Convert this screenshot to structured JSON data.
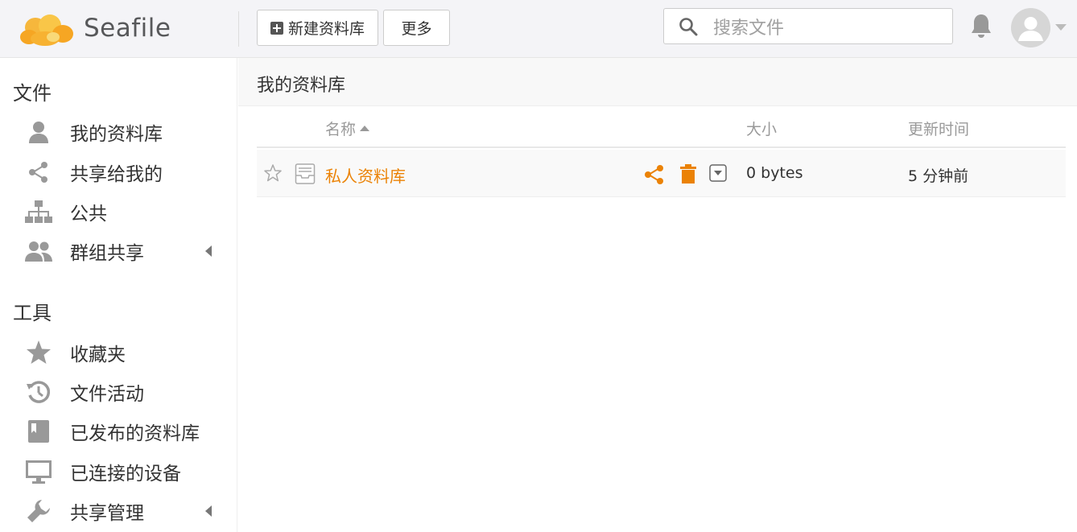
{
  "brand": {
    "name": "Seafile",
    "accent": "#eb8205",
    "logo_color": "#f6b73c"
  },
  "header": {
    "new_library_label": "新建资料库",
    "more_label": "更多",
    "search_placeholder": "搜索文件",
    "icons": {
      "new": "plus-square-icon",
      "search": "search-icon",
      "notifications": "bell-icon",
      "avatar": "user-avatar-icon"
    }
  },
  "sidebar": {
    "files_heading": "文件",
    "files_items": [
      {
        "label": "我的资料库",
        "icon": "user-icon"
      },
      {
        "label": "共享给我的",
        "icon": "share-icon"
      },
      {
        "label": "公共",
        "icon": "sitemap-icon"
      },
      {
        "label": "群组共享",
        "icon": "group-icon",
        "expandable": true
      }
    ],
    "tools_heading": "工具",
    "tools_items": [
      {
        "label": "收藏夹",
        "icon": "star-icon"
      },
      {
        "label": "文件活动",
        "icon": "history-icon"
      },
      {
        "label": "已发布的资料库",
        "icon": "book-icon"
      },
      {
        "label": "已连接的设备",
        "icon": "monitor-icon"
      },
      {
        "label": "共享管理",
        "icon": "wrench-icon",
        "expandable": true
      }
    ]
  },
  "main": {
    "title": "我的资料库",
    "columns": {
      "name": "名称",
      "size": "大小",
      "updated": "更新时间"
    },
    "rows": [
      {
        "name": "私人资料库",
        "size": "0 bytes",
        "updated": "5 分钟前",
        "starred": false
      }
    ]
  }
}
